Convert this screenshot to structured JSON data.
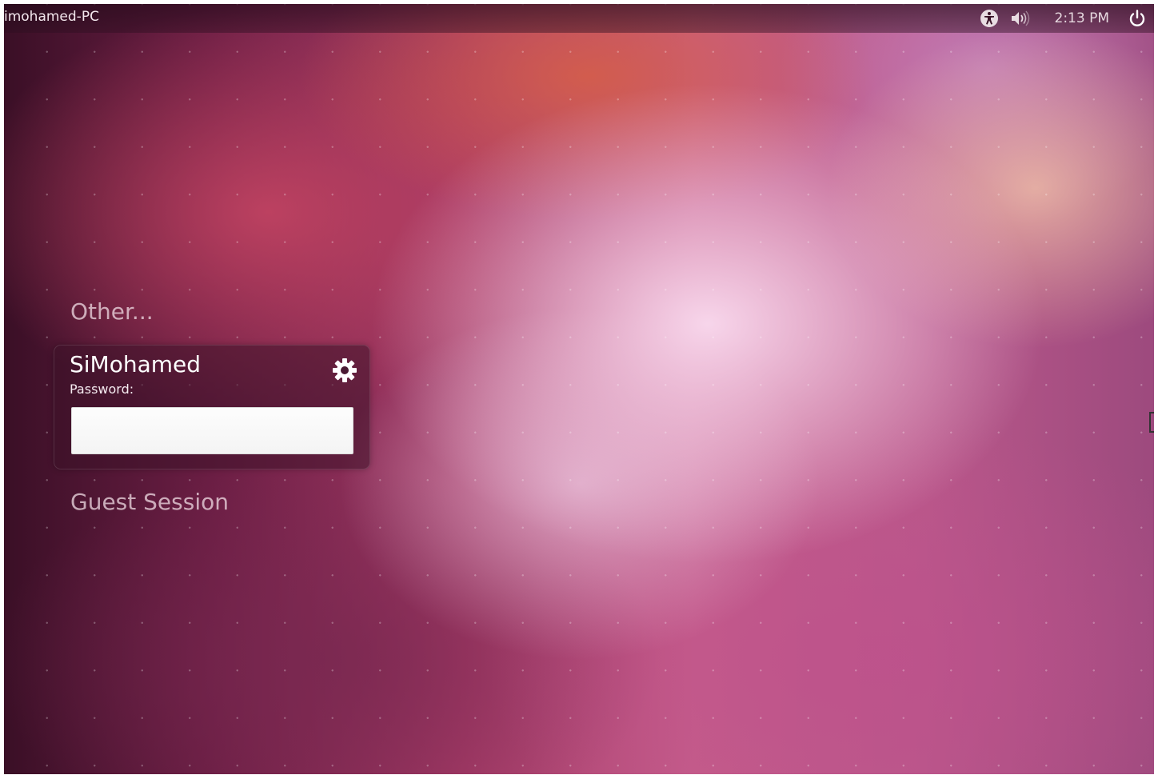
{
  "top_panel": {
    "hostname": "imohamed-PC",
    "clock": "2:13 PM",
    "icons": [
      "accessibility-icon",
      "volume-icon",
      "power-icon"
    ]
  },
  "login": {
    "other_label": "Other...",
    "user_name": "SiMohamed",
    "password_label": "Password:",
    "password_value": "",
    "session_icon": "gear-icon",
    "guest_label": "Guest Session"
  },
  "colors": {
    "panel_bg": "#2b0c1f",
    "wallpaper_dark": "#3a0f26",
    "wallpaper_highlight": "#f6d3ea",
    "accent_orange": "#d75f46"
  }
}
